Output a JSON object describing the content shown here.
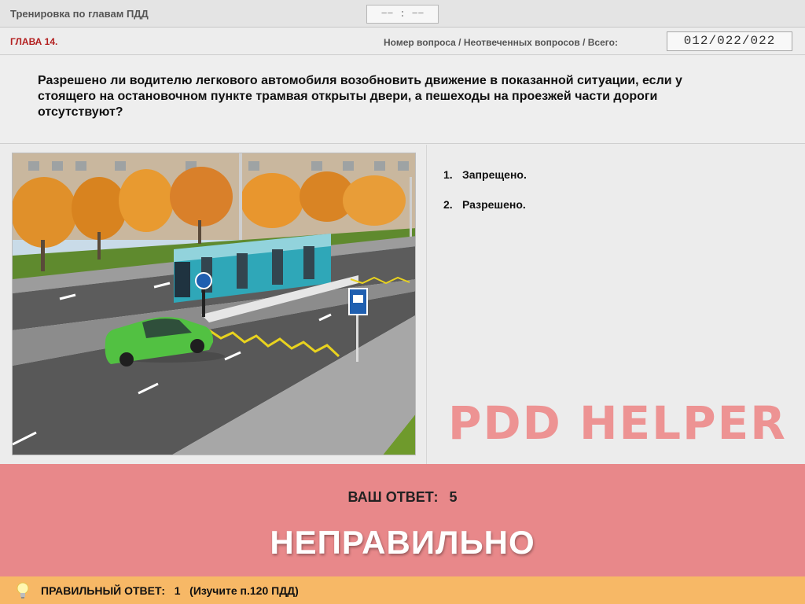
{
  "header": {
    "app_title": "Тренировка по главам ПДД",
    "timer": "−− : −−"
  },
  "subheader": {
    "chapter": "ГЛАВА 14.",
    "counter_label": "Номер вопроса / Неотвеченных вопросов / Всего:",
    "counter_value": "012/022/022"
  },
  "question": {
    "text": "Разрешено ли водителю легкового автомобиля возобновить движение в показанной ситуации, если у стоящего на остановочном пункте трамвая открыты двери, а пешеходы на проезжей части дороги отсутствуют?"
  },
  "answers": [
    {
      "number": "1.",
      "label": "Запрещено."
    },
    {
      "number": "2.",
      "label": "Разрешено."
    }
  ],
  "watermark": "PDD HELPER",
  "result": {
    "your_answer_label": "ВАШ  ОТВЕТ:",
    "your_answer_value": "5",
    "verdict": "НЕПРАВИЛЬНО",
    "color": "#e8888a"
  },
  "hint": {
    "text": "ПРАВИЛЬНЫЙ ОТВЕТ:   1   (Изучите п.120 ПДД)",
    "color": "#f7b866",
    "icon": "lightbulb-icon"
  }
}
